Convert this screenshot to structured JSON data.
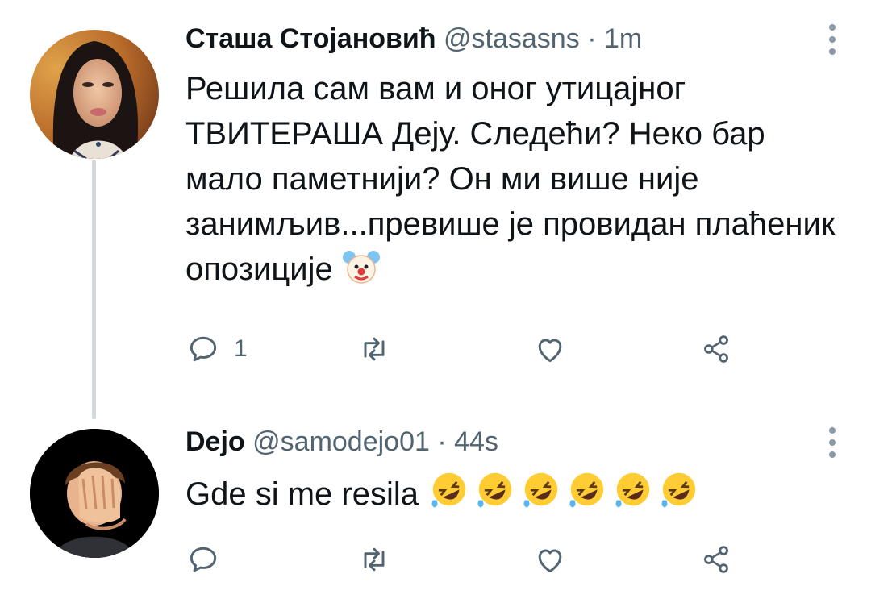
{
  "tweets": [
    {
      "name": "Сташа Стојановић",
      "handle": "@stasasns",
      "separator": "·",
      "time": "1m",
      "text": "Решила сам вам и оног утицајног ТВИТЕРАША Деју. Следећи? Неко бар мало паметнији? Он ми више није занимљив...превише је провидан плаћеник опозиције",
      "emoji": [
        "clown-face"
      ],
      "replies": "1",
      "avatar": "woman-portrait"
    },
    {
      "name": "Dejo",
      "handle": "@samodejo01",
      "separator": "·",
      "time": "44s",
      "text": "Gde si me resila",
      "emoji": [
        "rofl",
        "rofl",
        "rofl",
        "rofl",
        "rofl",
        "rofl"
      ],
      "replies": "",
      "avatar": "facepalm-memoji"
    }
  ],
  "colors": {
    "text": "#0f1419",
    "secondary": "#536471",
    "thread_line": "#cfd9de"
  }
}
